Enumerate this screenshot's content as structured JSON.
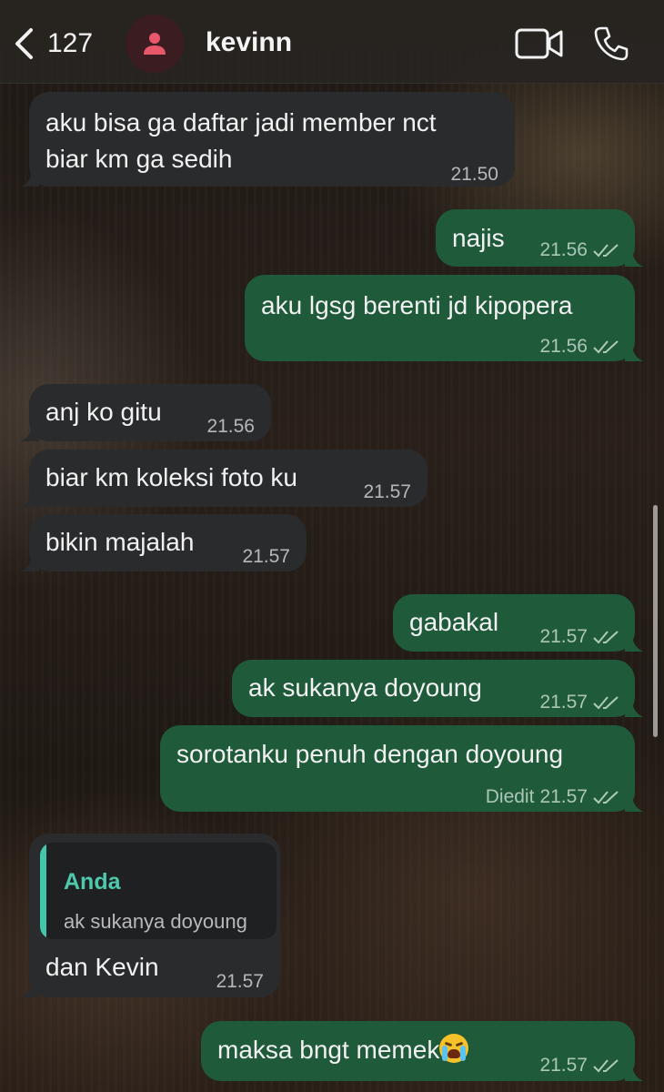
{
  "header": {
    "back_count": "127",
    "contact_name": "kevinn",
    "icons": [
      "back-chevron-icon",
      "contact-avatar-icon",
      "video-call-icon",
      "phone-call-icon"
    ]
  },
  "colors": {
    "incoming_bubble": "#2a2b2d",
    "outgoing_bubble": "#1f5a3a",
    "reply_accent": "#43c6ac",
    "avatar_accent": "#e8586a"
  },
  "messages": [
    {
      "direction": "in",
      "text_line1": "aku bisa ga daftar jadi member nct",
      "text_line2": "biar km ga sedih",
      "time": "21.50"
    },
    {
      "direction": "out",
      "text": "najis",
      "time": "21.56",
      "status": "read"
    },
    {
      "direction": "out",
      "text": "aku lgsg berenti jd kipopera",
      "time": "21.56",
      "status": "read"
    },
    {
      "direction": "in",
      "text": "anj ko gitu",
      "time": "21.56"
    },
    {
      "direction": "in",
      "text": "biar km koleksi foto ku",
      "time": "21.57"
    },
    {
      "direction": "in",
      "text": "bikin majalah",
      "time": "21.57"
    },
    {
      "direction": "out",
      "text": "gabakal",
      "time": "21.57",
      "status": "read"
    },
    {
      "direction": "out",
      "text": "ak sukanya doyoung",
      "time": "21.57",
      "status": "read"
    },
    {
      "direction": "out",
      "text": "sorotanku penuh dengan doyoung",
      "edited_label": "Diedit",
      "time": "21.57",
      "status": "read"
    },
    {
      "direction": "in",
      "reply_author": "Anda",
      "reply_text": "ak sukanya doyoung",
      "text": "dan Kevin",
      "time": "21.57"
    },
    {
      "direction": "out",
      "text": "maksa bngt memek",
      "emoji": "loudly-crying-face-icon",
      "time": "21.57",
      "status": "read"
    }
  ]
}
